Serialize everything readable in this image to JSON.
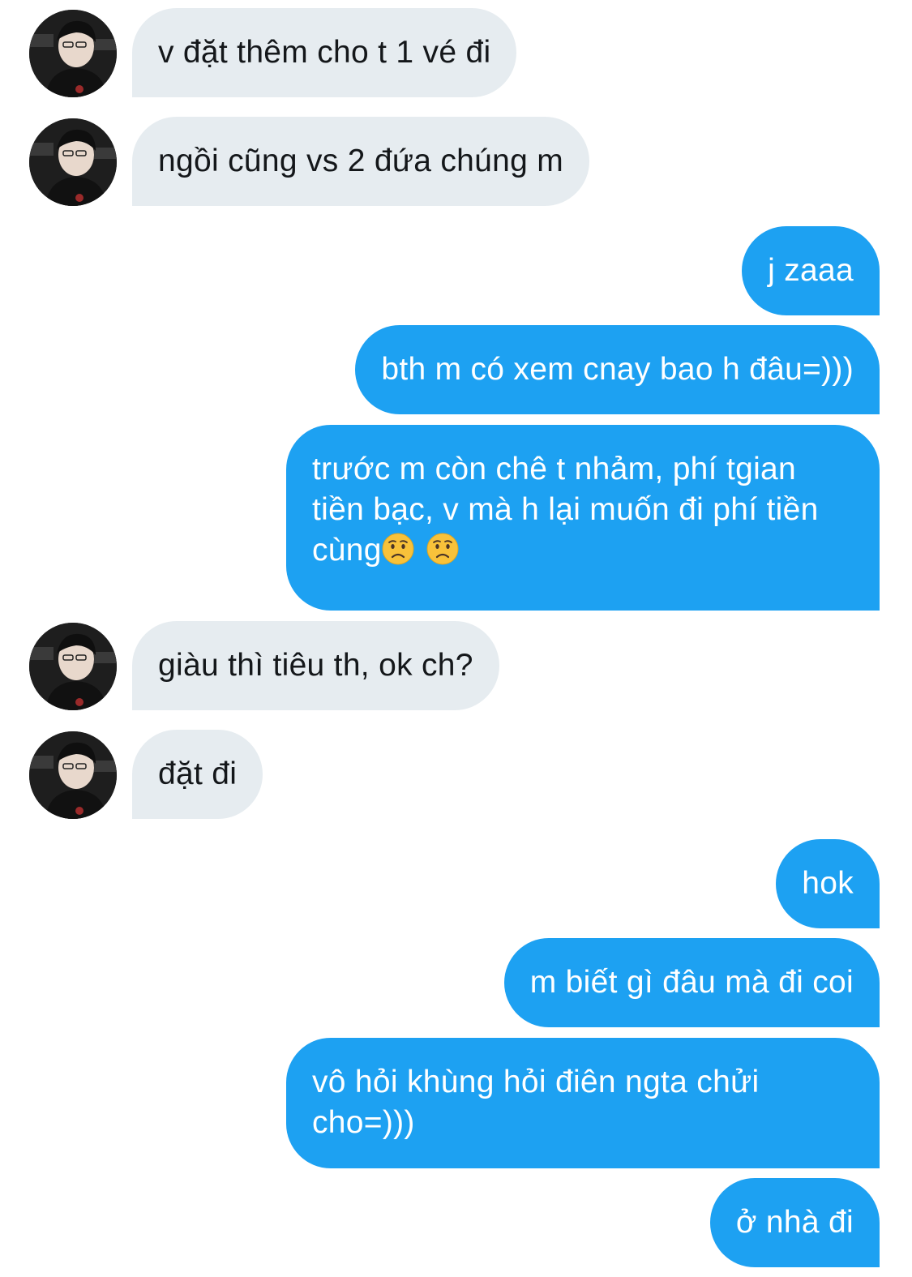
{
  "conversation": {
    "messages": [
      {
        "from": "other",
        "text": "v đặt thêm cho t 1 vé đi"
      },
      {
        "from": "other",
        "text": "ngồi cũng vs 2 đứa chúng m"
      },
      {
        "from": "me",
        "text": "j zaaa"
      },
      {
        "from": "me",
        "text": "bth m có xem cnay bao h đâu=)))"
      },
      {
        "from": "me",
        "text": "trước m còn chê t nhảm, phí tgian tiền bạc, v mà h lại muốn đi phí tiền cùng",
        "emoji": [
          "worried-face",
          "worried-face"
        ]
      },
      {
        "from": "other",
        "text": "giàu thì tiêu th, ok ch?"
      },
      {
        "from": "other",
        "text": "đặt đi"
      },
      {
        "from": "me",
        "text": "hok"
      },
      {
        "from": "me",
        "text": "m biết gì đâu mà đi coi"
      },
      {
        "from": "me",
        "text": "vô hỏi khùng hỏi điên ngta chửi cho=)))"
      },
      {
        "from": "me",
        "text": "ở nhà đi"
      }
    ]
  },
  "colors": {
    "incoming_bubble": "#e6ecf0",
    "incoming_text": "#14171a",
    "outgoing_bubble": "#1da1f2",
    "outgoing_text": "#ffffff"
  },
  "icons": {
    "avatar": "contact-avatar",
    "emoji": "worried-face"
  }
}
